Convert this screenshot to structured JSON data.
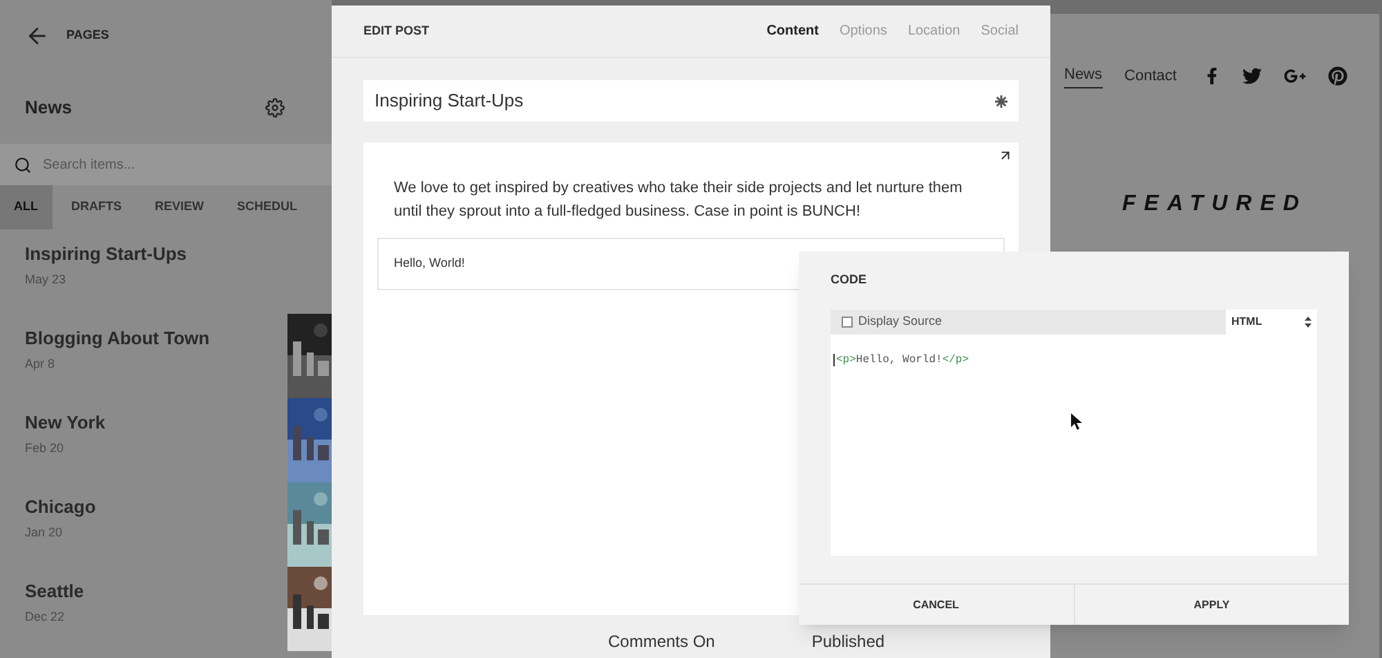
{
  "sidebar": {
    "back_label": "PAGES",
    "title": "News",
    "search": {
      "placeholder": "Search items..."
    },
    "tabs": [
      {
        "label": "ALL",
        "selected": true
      },
      {
        "label": "DRAFTS",
        "selected": false
      },
      {
        "label": "REVIEW",
        "selected": false
      },
      {
        "label": "SCHEDUL",
        "selected": false
      }
    ],
    "items": [
      {
        "title": "Inspiring Start-Ups",
        "date": "May 23",
        "thumbnail": false
      },
      {
        "title": "Blogging About Town",
        "date": "Apr 8",
        "thumbnail": true
      },
      {
        "title": "New York",
        "date": "Feb 20",
        "thumbnail": true
      },
      {
        "title": "Chicago",
        "date": "Jan 20",
        "thumbnail": true
      },
      {
        "title": "Seattle",
        "date": "Dec 22",
        "thumbnail": true
      }
    ]
  },
  "site": {
    "nav": [
      {
        "label": "News",
        "selected": true
      },
      {
        "label": "Contact",
        "selected": false
      }
    ],
    "heading": "FEATURED"
  },
  "edit_post": {
    "title": "EDIT POST",
    "tabs": [
      {
        "label": "Content",
        "selected": true
      },
      {
        "label": "Options",
        "selected": false
      },
      {
        "label": "Location",
        "selected": false
      },
      {
        "label": "Social",
        "selected": false
      }
    ],
    "post_title": "Inspiring Start-Ups",
    "body": "We love to get inspired by creatives who take their side projects and let nurture them until they sprout into a full-fledged business. Case in point is BUNCH!",
    "code_block": "Hello, World!",
    "footer": [
      "Comments On",
      "Published"
    ]
  },
  "code_dialog": {
    "title": "CODE",
    "display_source": {
      "label": "Display Source",
      "checked": false
    },
    "language": "HTML",
    "code": [
      {
        "kind": "tag",
        "text": "<p>"
      },
      {
        "kind": "text",
        "text": "Hello, World!"
      },
      {
        "kind": "tag",
        "text": "</p>"
      }
    ],
    "buttons": [
      "CANCEL",
      "APPLY"
    ]
  }
}
